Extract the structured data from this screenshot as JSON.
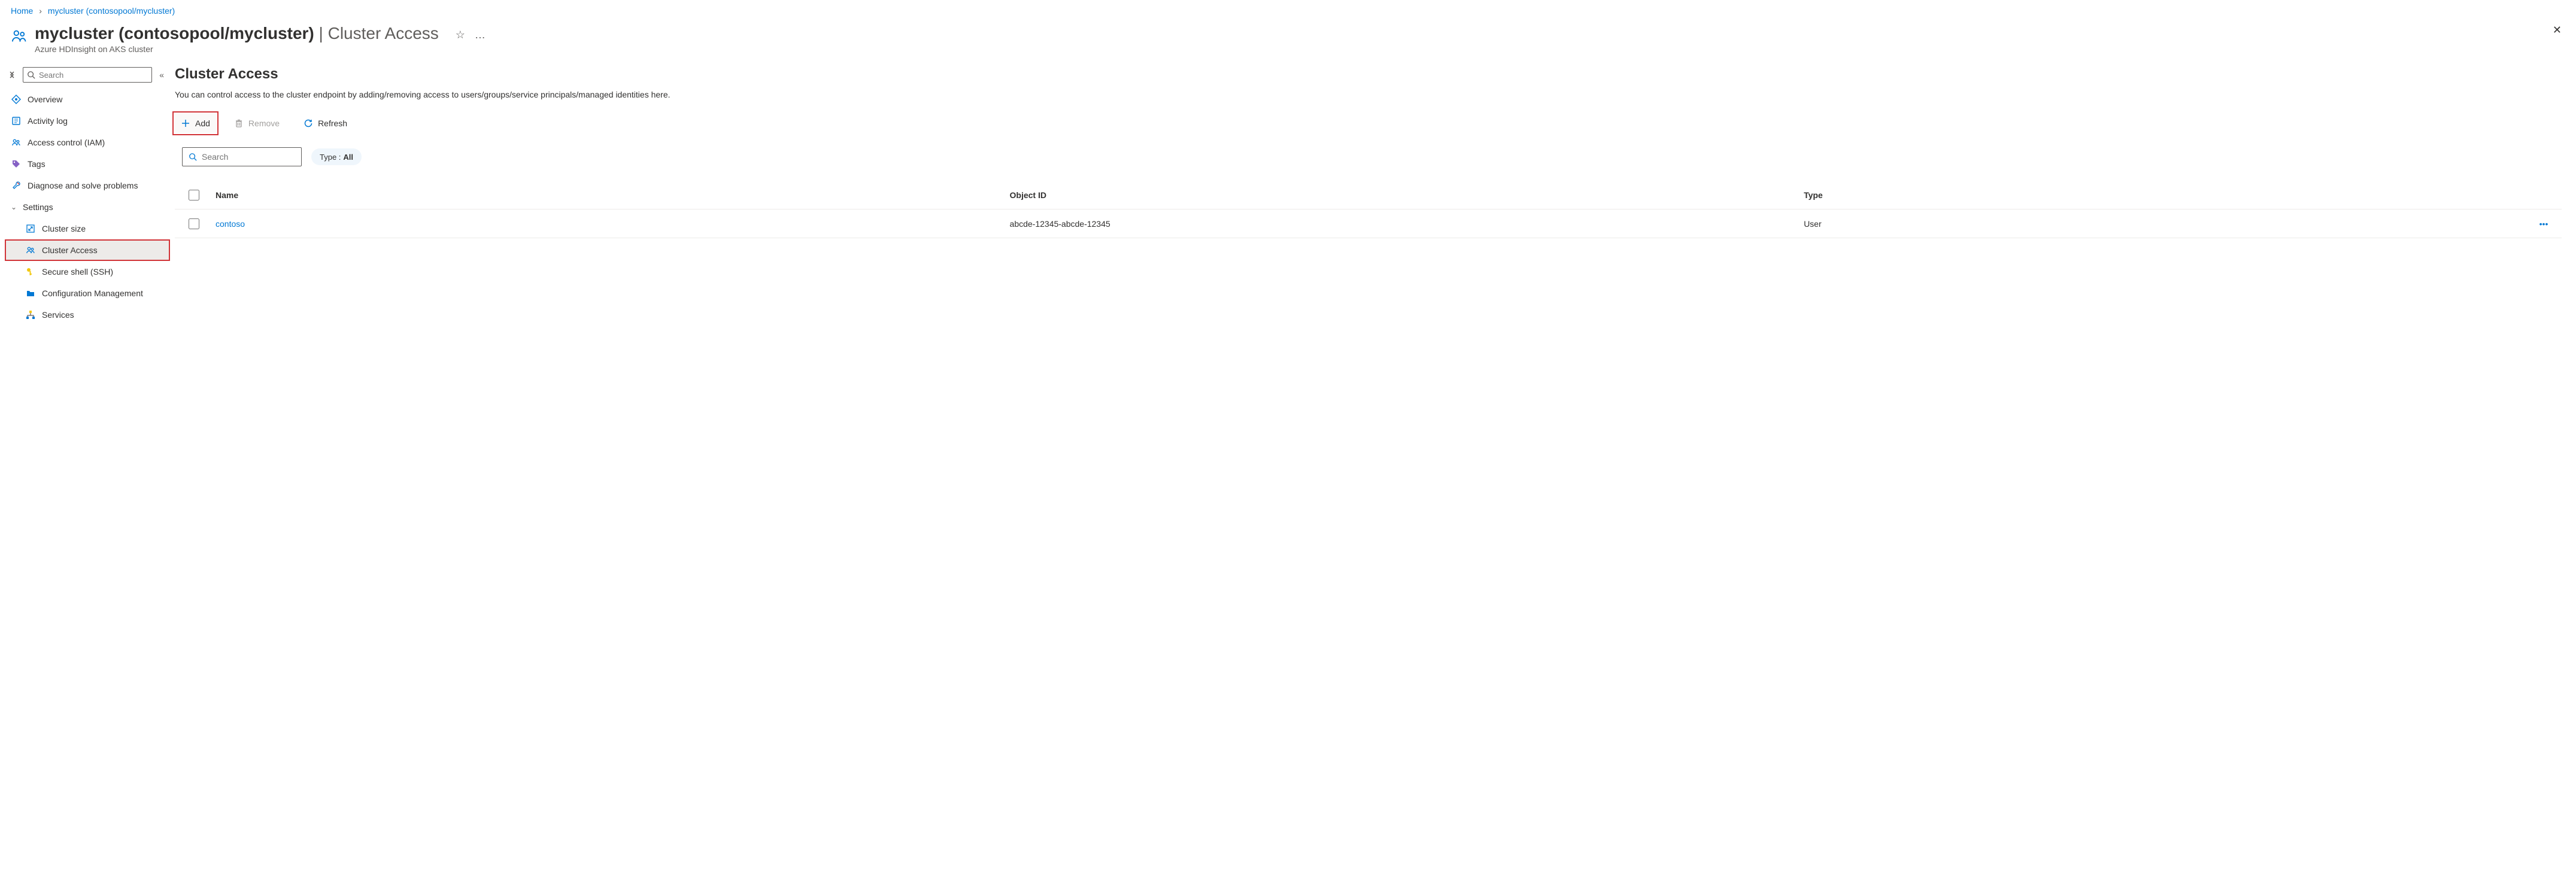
{
  "breadcrumb": {
    "home": "Home",
    "resource": "mycluster (contosopool/mycluster)"
  },
  "header": {
    "title_main": "mycluster (contosopool/mycluster)",
    "title_section": "Cluster Access",
    "subtitle": "Azure HDInsight on AKS cluster"
  },
  "sidebar": {
    "search_placeholder": "Search",
    "items": {
      "overview": "Overview",
      "activity_log": "Activity log",
      "iam": "Access control (IAM)",
      "tags": "Tags",
      "diagnose": "Diagnose and solve problems",
      "settings": "Settings",
      "cluster_size": "Cluster size",
      "cluster_access": "Cluster Access",
      "ssh": "Secure shell (SSH)",
      "config_mgmt": "Configuration Management",
      "services": "Services"
    }
  },
  "main": {
    "heading": "Cluster Access",
    "description": "You can control access to the cluster endpoint by adding/removing access to users/groups/service principals/managed identities here.",
    "toolbar": {
      "add": "Add",
      "remove": "Remove",
      "refresh": "Refresh"
    },
    "filter": {
      "search_placeholder": "Search",
      "type_label": "Type : ",
      "type_value": "All"
    },
    "table": {
      "columns": {
        "name": "Name",
        "object_id": "Object ID",
        "type": "Type"
      },
      "rows": [
        {
          "name": "contoso",
          "object_id": "abcde-12345-abcde-12345",
          "type": "User"
        }
      ]
    }
  }
}
